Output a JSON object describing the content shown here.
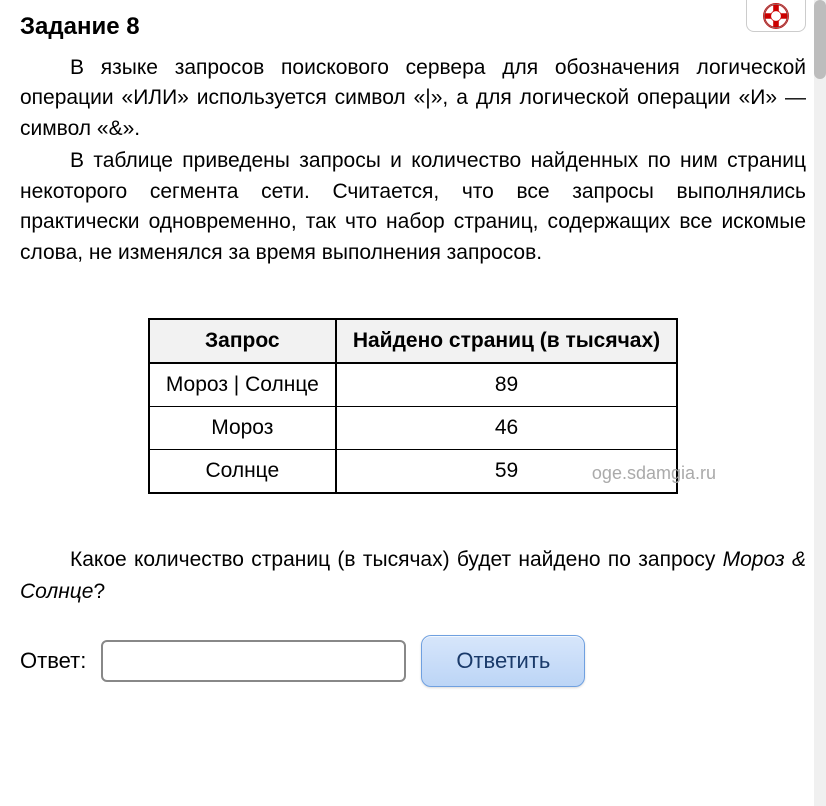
{
  "task": {
    "title": "Задание 8",
    "p1": "В языке запросов поискового сервера для обозначения логической операции «ИЛИ» используется символ «|», а для логической операции «И» — символ «&».",
    "p2": "В таблице приведены запросы и количество найденных по ним страниц некоторого сегмента сети. Считается, что все запросы выполнялись практически одновременно, так что набор страниц, содержащих все искомые слова, не изменялся за время выполнения запросов."
  },
  "table": {
    "headers": {
      "c1": "Запрос",
      "c2": "Найдено страниц (в тысячах)"
    },
    "rows": [
      {
        "query": "Мороз | Солнце",
        "count": "89"
      },
      {
        "query": "Мороз",
        "count": "46"
      },
      {
        "query": "Солнце",
        "count": "59"
      }
    ]
  },
  "chart_data": {
    "type": "table",
    "columns": [
      "Запрос",
      "Найдено страниц (в тысячах)"
    ],
    "rows": [
      [
        "Мороз | Солнце",
        89
      ],
      [
        "Мороз",
        46
      ],
      [
        "Солнце",
        59
      ]
    ]
  },
  "watermark": "oge.sdamgia.ru",
  "question": {
    "prefix": "Какое количество страниц (в тысячах) будет найдено по запросу ",
    "italic": "Мороз & Солнце",
    "suffix": "?"
  },
  "answer": {
    "label": "Ответ:",
    "button": "Ответить"
  }
}
